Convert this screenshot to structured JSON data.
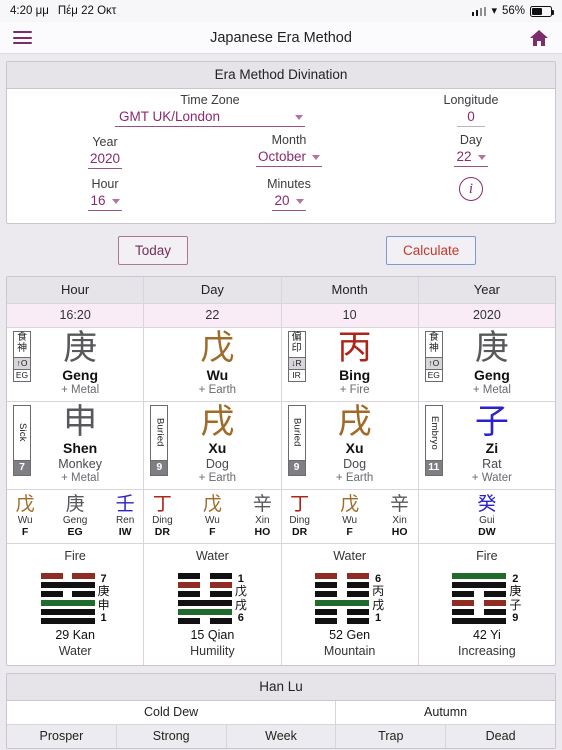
{
  "status_bar": {
    "time": "4:20 μμ",
    "date": "Πέμ 22 Οκτ",
    "battery": "56%"
  },
  "nav": {
    "title": "Japanese Era Method",
    "menu_icon": "hamburger-icon",
    "home_icon": "home-icon"
  },
  "form": {
    "panel_title": "Era Method Divination",
    "timezone": {
      "label": "Time Zone",
      "value": "GMT UK/London"
    },
    "longitude": {
      "label": "Longitude",
      "value": "0"
    },
    "year": {
      "label": "Year",
      "value": "2020"
    },
    "month": {
      "label": "Month",
      "value": "October"
    },
    "day": {
      "label": "Day",
      "value": "22"
    },
    "hour": {
      "label": "Hour",
      "value": "16"
    },
    "minutes": {
      "label": "Minutes",
      "value": "20"
    },
    "info_icon": "info-icon"
  },
  "buttons": {
    "today": "Today",
    "calculate": "Calculate"
  },
  "colors": {
    "accent": "#8b2a6e",
    "metal": "#58585c",
    "earth": "#a06a28",
    "fire": "#b02318",
    "water": "#2b22c9",
    "wood": "#1f6b2b",
    "header_bg": "#e6e4e8",
    "subheader_bg": "#f9ecf7"
  },
  "chart": {
    "headers": [
      "Hour",
      "Day",
      "Month",
      "Year"
    ],
    "subvalues": [
      "16:20",
      "22",
      "10",
      "2020"
    ],
    "pillars": [
      {
        "column": "Hour",
        "stem": {
          "badge": {
            "cjk": "食神",
            "arrow": "↑O",
            "code": "EG"
          },
          "han": "庚",
          "pinyin": "Geng",
          "element": "+ Metal",
          "color_class": "c-metal"
        },
        "branch": {
          "badge": {
            "vertical": "Sick",
            "number": "7"
          },
          "han": "申",
          "pinyin": "Shen",
          "animal": "Monkey",
          "element": "+ Metal",
          "color_class": "c-metal"
        },
        "hidden": [
          {
            "han": "戊",
            "pinyin": "Wu",
            "god": "F",
            "color_class": "c-earth"
          },
          {
            "han": "庚",
            "pinyin": "Geng",
            "god": "EG",
            "color_class": "c-metal"
          },
          {
            "han": "壬",
            "pinyin": "Ren",
            "god": "IW",
            "color_class": "c-water"
          }
        ],
        "hexagram": {
          "top": "Fire",
          "lines": [
            "solid",
            "solid",
            "green",
            "broken",
            "solid",
            "red"
          ],
          "side": [
            "7",
            "庚",
            "申",
            "1"
          ],
          "name": "29 Kan",
          "meaning": "Water"
        }
      },
      {
        "column": "Day",
        "stem": {
          "badge": null,
          "han": "戊",
          "pinyin": "Wu",
          "element": "+ Earth",
          "color_class": "c-earth"
        },
        "branch": {
          "badge": {
            "vertical": "Buried",
            "number": "9"
          },
          "han": "戌",
          "pinyin": "Xu",
          "animal": "Dog",
          "element": "+ Earth",
          "color_class": "c-earth"
        },
        "hidden": [
          {
            "han": "丁",
            "pinyin": "Ding",
            "god": "DR",
            "color_class": "c-fire"
          },
          {
            "han": "戊",
            "pinyin": "Wu",
            "god": "F",
            "color_class": "c-earth"
          },
          {
            "han": "辛",
            "pinyin": "Xin",
            "god": "HO",
            "color_class": "c-metal"
          }
        ],
        "hexagram": {
          "top": "Water",
          "lines": [
            "broken",
            "green",
            "solid",
            "broken",
            "red",
            "broken"
          ],
          "side": [
            "1",
            "戊",
            "戌",
            "6"
          ],
          "name": "15 Qian",
          "meaning": "Humility"
        }
      },
      {
        "column": "Month",
        "stem": {
          "badge": {
            "cjk": "偏印",
            "arrow": "↓R",
            "code": "IR"
          },
          "han": "丙",
          "pinyin": "Bing",
          "element": "+ Fire",
          "color_class": "c-fire"
        },
        "branch": {
          "badge": {
            "vertical": "Buried",
            "number": "9"
          },
          "han": "戌",
          "pinyin": "Xu",
          "animal": "Dog",
          "element": "+ Earth",
          "color_class": "c-earth"
        },
        "hidden": [
          {
            "han": "丁",
            "pinyin": "Ding",
            "god": "DR",
            "color_class": "c-fire"
          },
          {
            "han": "戊",
            "pinyin": "Wu",
            "god": "F",
            "color_class": "c-earth"
          },
          {
            "han": "辛",
            "pinyin": "Xin",
            "god": "HO",
            "color_class": "c-metal"
          }
        ],
        "hexagram": {
          "top": "Water",
          "lines": [
            "broken",
            "broken",
            "green",
            "broken",
            "broken",
            "red"
          ],
          "side": [
            "6",
            "丙",
            "戌",
            "1"
          ],
          "name": "52 Gen",
          "meaning": "Mountain"
        }
      },
      {
        "column": "Year",
        "stem": {
          "badge": {
            "cjk": "食神",
            "arrow": "↑O",
            "code": "EG"
          },
          "han": "庚",
          "pinyin": "Geng",
          "element": "+ Metal",
          "color_class": "c-metal"
        },
        "branch": {
          "badge": {
            "vertical": "Embryo",
            "number": "11"
          },
          "han": "子",
          "pinyin": "Zi",
          "animal": "Rat",
          "element": "+ Water",
          "color_class": "c-water"
        },
        "hidden": [
          {
            "han": "癸",
            "pinyin": "Gui",
            "god": "DW",
            "color_class": "c-water"
          }
        ],
        "hexagram": {
          "top": "Fire",
          "lines": [
            "solid",
            "broken",
            "red",
            "broken",
            "solid",
            "green"
          ],
          "side": [
            "2",
            "庚",
            "子",
            "9"
          ],
          "name": "42 Yi",
          "meaning": "Increasing"
        }
      }
    ]
  },
  "footer": {
    "title": "Han Lu",
    "seasons": [
      {
        "label": "Cold Dew",
        "span": 3
      },
      {
        "label": "Autumn",
        "span": 2
      }
    ],
    "phases": [
      "Prosper",
      "Strong",
      "Week",
      "Trap",
      "Dead"
    ]
  }
}
